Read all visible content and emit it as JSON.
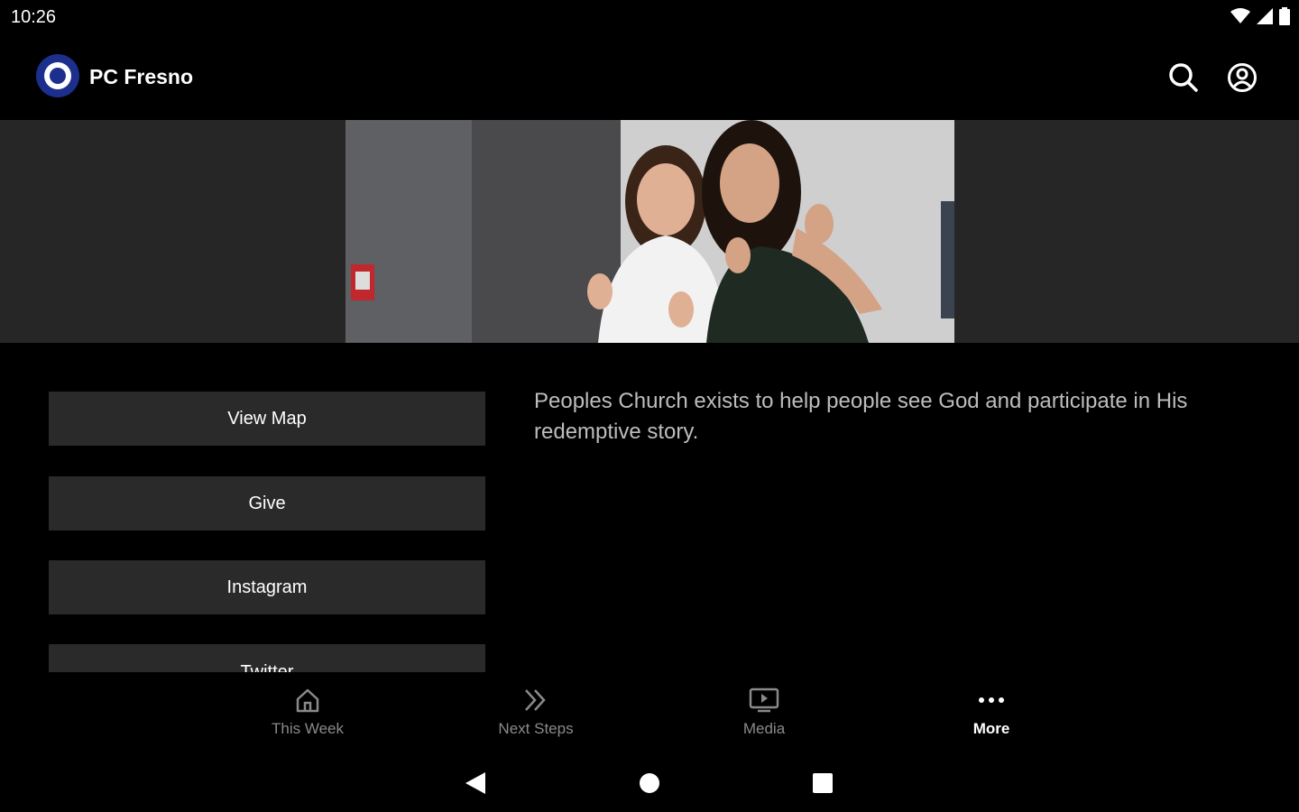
{
  "status_bar": {
    "time": "10:26",
    "icons": [
      "wifi-icon",
      "signal-icon",
      "battery-icon"
    ]
  },
  "app_bar": {
    "title": "PC Fresno",
    "logo_color": "#1c2f8c",
    "actions": [
      "search-icon",
      "account-icon"
    ]
  },
  "hero": {
    "image_name": "hero-photo"
  },
  "links": [
    {
      "label": "View Map"
    },
    {
      "label": "Give"
    },
    {
      "label": "Instagram"
    },
    {
      "label": "Twitter"
    }
  ],
  "description": "Peoples Church exists to help people see God and participate in His redemptive story.",
  "bottom_nav": {
    "items": [
      {
        "label": "This Week",
        "icon": "home-icon",
        "active": false
      },
      {
        "label": "Next Steps",
        "icon": "double-chevron-right-icon",
        "active": false
      },
      {
        "label": "Media",
        "icon": "tv-play-icon",
        "active": false
      },
      {
        "label": "More",
        "icon": "more-horizontal-icon",
        "active": true
      }
    ]
  },
  "system_nav": [
    "back-icon",
    "home-circle-icon",
    "recents-icon"
  ]
}
